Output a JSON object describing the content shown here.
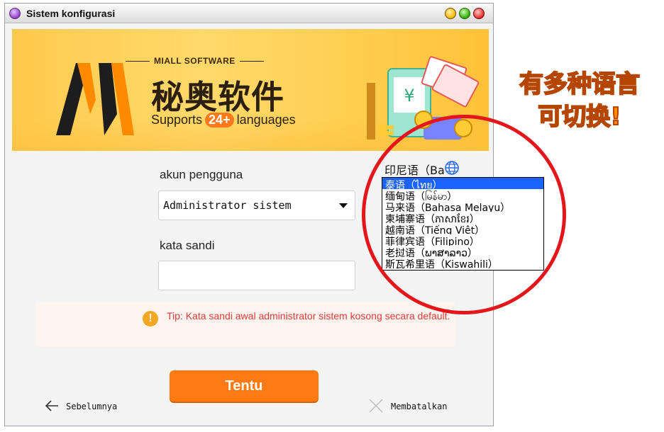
{
  "window": {
    "title": "Sistem konfigurasi"
  },
  "banner": {
    "brand_small": "MIALL SOFTWARE",
    "brand_big": "秘奥软件",
    "sub_prefix": "Supports",
    "sub_badge": "24+",
    "sub_suffix": "languages"
  },
  "form": {
    "user_label": "akun pengguna",
    "user_value": "Administrator sistem",
    "password_label": "kata sandi",
    "password_value": ""
  },
  "tip": {
    "icon": "!",
    "text": "Tip: Kata sandi awal administrator sistem kosong secara default."
  },
  "buttons": {
    "confirm": "Tentu",
    "back": "Sebelumnya",
    "cancel": "Membatalkan"
  },
  "language": {
    "current": "印尼语（Ba",
    "options": [
      "泰语（ไทย）",
      "缅甸语（မြန်မာ）",
      "马来语（Bahasa Melayu）",
      "柬埔寨语（ភាសាខ្មែរ）",
      "越南语（Tiếng Việt）",
      "菲律宾语（Filipino）",
      "老挝语（ພາສາລາວ）",
      "斯瓦希里语（Kiswahili）"
    ],
    "selected_index": 0
  },
  "annotation": {
    "line1": "有多种语言",
    "line2": "可切换!"
  },
  "colors": {
    "accent": "#ff7a12",
    "tip_text": "#e23b3b",
    "selection": "#1b63ff",
    "highlight_circle": "#e5161b",
    "annotation": "#ff8a00"
  }
}
